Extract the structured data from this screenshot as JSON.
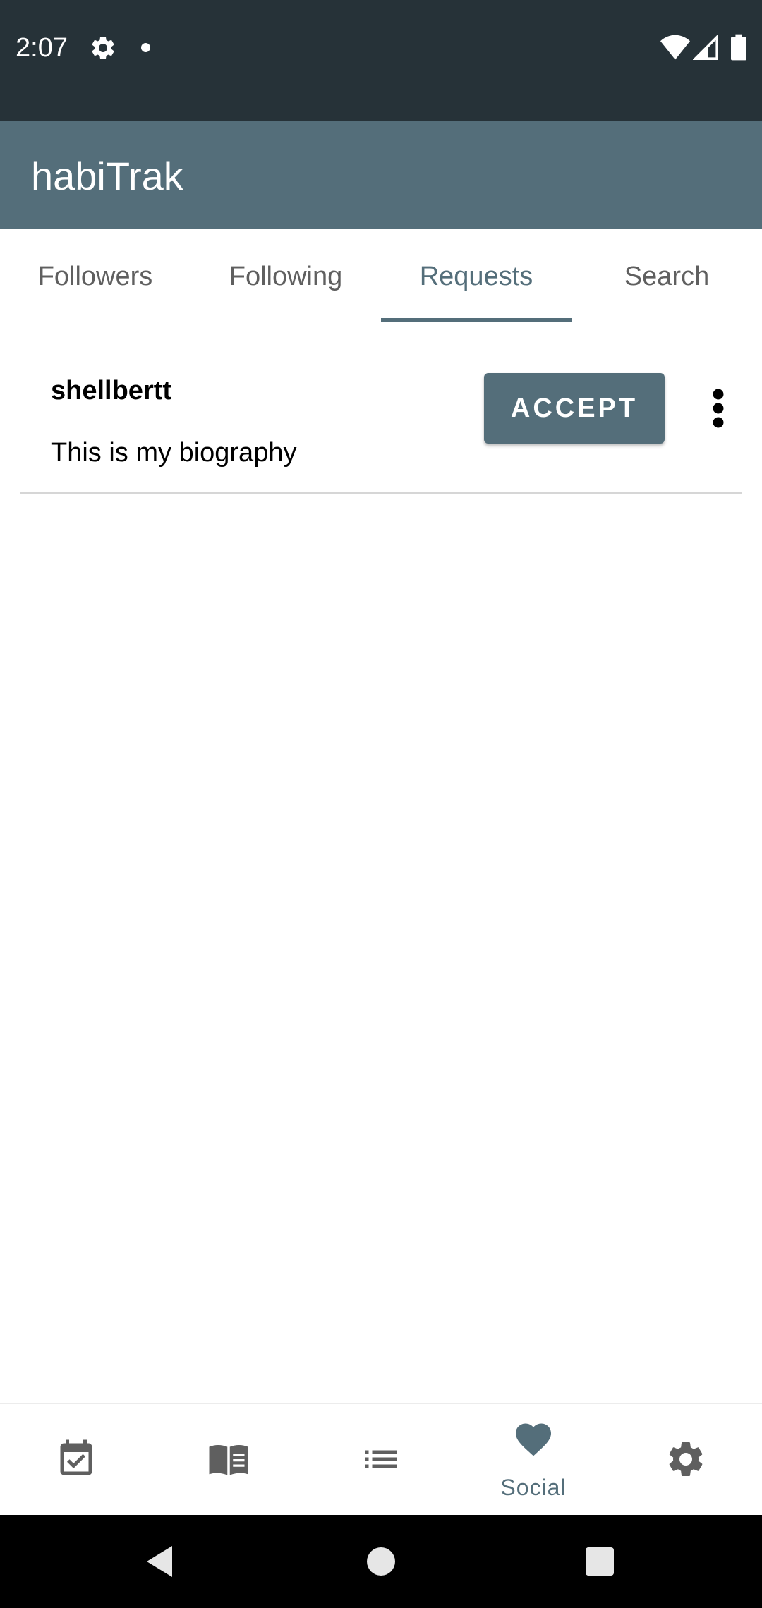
{
  "status_bar": {
    "time": "2:07",
    "icons": [
      "settings-icon",
      "notification-dot-icon",
      "wifi-icon",
      "signal-icon",
      "battery-icon"
    ]
  },
  "app_bar": {
    "title": "habiTrak"
  },
  "tabs": [
    {
      "label": "Followers",
      "active": false
    },
    {
      "label": "Following",
      "active": false
    },
    {
      "label": "Requests",
      "active": true
    },
    {
      "label": "Search",
      "active": false
    }
  ],
  "requests": [
    {
      "username": "shellbertt",
      "bio": "This is my biography",
      "accept_label": "ACCEPT"
    }
  ],
  "bottom_nav": {
    "items": [
      {
        "icon": "calendar-check-icon",
        "label": ""
      },
      {
        "icon": "book-icon",
        "label": ""
      },
      {
        "icon": "list-icon",
        "label": ""
      },
      {
        "icon": "heart-icon",
        "label": "Social",
        "active": true
      },
      {
        "icon": "settings-icon",
        "label": ""
      }
    ]
  },
  "colors": {
    "status_bar": "#263238",
    "primary": "#546e7a",
    "icon_grey": "#5f5f5f",
    "nav_bar": "#000000"
  }
}
